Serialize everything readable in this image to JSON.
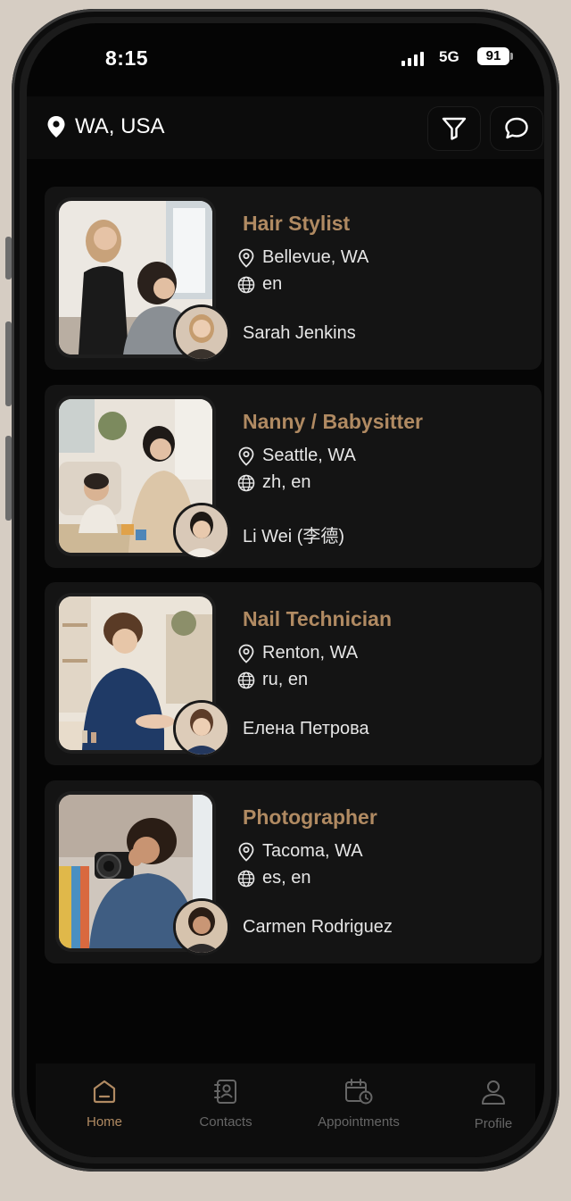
{
  "status": {
    "time": "8:15",
    "network": "5G",
    "battery": "91"
  },
  "header": {
    "location": "WA, USA"
  },
  "listings": [
    {
      "role": "Hair Stylist",
      "city": "Bellevue, WA",
      "languages": "en",
      "name": "Sarah Jenkins"
    },
    {
      "role": "Nanny / Babysitter",
      "city": "Seattle, WA",
      "languages": "zh, en",
      "name": "Li Wei (李德)"
    },
    {
      "role": "Nail Technician",
      "city": "Renton, WA",
      "languages": "ru, en",
      "name": "Елена Петрова"
    },
    {
      "role": "Photographer",
      "city": "Tacoma, WA",
      "languages": "es, en",
      "name": "Carmen Rodriguez"
    }
  ],
  "tabs": [
    {
      "label": "Home",
      "icon": "home-icon",
      "active": true
    },
    {
      "label": "Contacts",
      "icon": "contacts-icon",
      "active": false
    },
    {
      "label": "Appointments",
      "icon": "calendar-icon",
      "active": false
    },
    {
      "label": "Profile",
      "icon": "profile-icon",
      "active": false
    }
  ],
  "colors": {
    "accent": "#b08a62",
    "card": "#141414",
    "background": "#050505"
  }
}
